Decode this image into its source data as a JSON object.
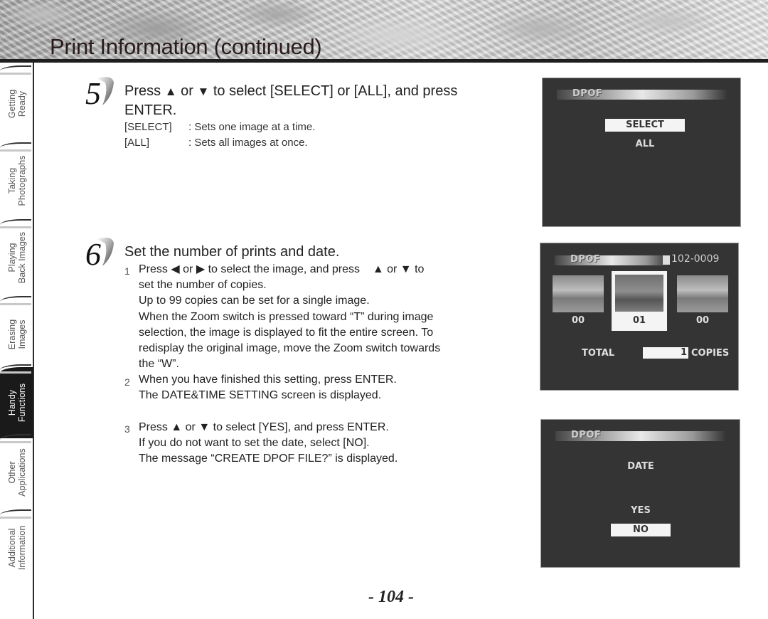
{
  "header": {
    "title": "Print Information (continued)"
  },
  "side_tabs": [
    {
      "line1": "Getting",
      "line2": "Ready",
      "active": false
    },
    {
      "line1": "Taking",
      "line2": "Photographs",
      "active": false
    },
    {
      "line1": "Playing",
      "line2": "Back Images",
      "active": false
    },
    {
      "line1": "Erasing",
      "line2": "Images",
      "active": false
    },
    {
      "line1": "Handy",
      "line2": "Functions",
      "active": true
    },
    {
      "line1": "Other",
      "line2": "Applications",
      "active": false
    },
    {
      "line1": "Additional",
      "line2": "Information",
      "active": false
    }
  ],
  "step5": {
    "number": "5",
    "heading_pre": "Press",
    "up_icon": "▲",
    "or": "or",
    "down_icon": "▼",
    "heading_post": "to select [SELECT] or [ALL], and press",
    "heading_line2": "ENTER.",
    "definitions": [
      {
        "term": "[SELECT]",
        "desc": ": Sets one image at a time."
      },
      {
        "term": "[ALL]",
        "desc": ": Sets all images at once."
      }
    ]
  },
  "step6": {
    "number": "6",
    "heading": "Set the number of prints and date.",
    "substeps": [
      {
        "num": "1",
        "line1_pre": "Press",
        "left_icon": "◀",
        "or1": "or",
        "right_icon": "▶",
        "line1_mid": "to select the image, and press",
        "up_icon": "▲",
        "or2": "or",
        "down_icon": "▼",
        "line1_post": "to",
        "lines": [
          "set the number of copies.",
          "Up to 99 copies can be set for a single image.",
          "When the Zoom switch is pressed toward “T” during image",
          "selection, the image is displayed to fit the entire screen. To",
          "redisplay the original image, move the Zoom switch towards",
          "the “W”."
        ]
      },
      {
        "num": "2",
        "lines": [
          "When you have finished this setting, press ENTER.",
          "The DATE&TIME SETTING screen is displayed."
        ]
      },
      {
        "num": "3",
        "line1_pre": "Press",
        "up_icon": "▲",
        "or": "or",
        "down_icon": "▼",
        "line1_post": "to select [YES], and press ENTER.",
        "lines": [
          "If you do not want to set the date, select [NO].",
          "The message “CREATE DPOF FILE?” is displayed."
        ]
      }
    ]
  },
  "screens": {
    "select_screen": {
      "title": "DPOF",
      "options": [
        "SELECT",
        "ALL"
      ],
      "selected": "SELECT"
    },
    "copies_screen": {
      "title": "DPOF",
      "file_icon": "file-icon",
      "file_number": "102-0009",
      "thumbnails": [
        {
          "count": "00",
          "selected": false
        },
        {
          "count": "01",
          "selected": true
        },
        {
          "count": "00",
          "selected": false
        }
      ],
      "total_label": "TOTAL",
      "total_value": "1",
      "copies_label": "COPIES"
    },
    "date_screen": {
      "title": "DPOF",
      "prompt": "DATE",
      "options": [
        "YES",
        "NO"
      ],
      "selected": "NO"
    }
  },
  "footer": {
    "page_number": "- 104 -"
  }
}
